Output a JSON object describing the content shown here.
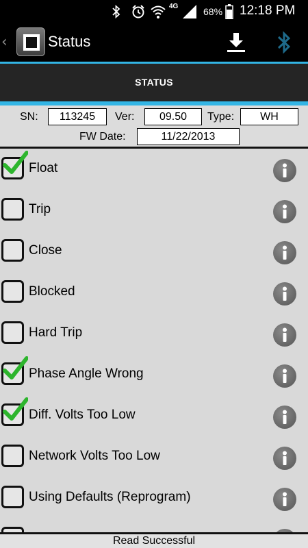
{
  "status_bar": {
    "battery_percent": "68%",
    "network": "4G",
    "time": "12:18 PM",
    "icons": [
      "bluetooth-icon",
      "alarm-icon",
      "wifi-icon",
      "signal-icon",
      "battery-icon"
    ]
  },
  "action_bar": {
    "title": "Status",
    "icons": [
      "back-chevron-icon",
      "app-logo-icon",
      "download-icon",
      "bluetooth-icon"
    ],
    "bluetooth_color": "#1e6a8a"
  },
  "tabs": [
    {
      "label": "STATUS",
      "selected": true
    }
  ],
  "accent_color": "#33b5e5",
  "device_info": {
    "sn_label": "SN:",
    "sn_value": "113245",
    "ver_label": "Ver:",
    "ver_value": "09.50",
    "type_label": "Type:",
    "type_value": "WH",
    "fw_date_label": "FW Date:",
    "fw_date_value": "11/22/2013"
  },
  "status_items": [
    {
      "label": "Float",
      "checked": true
    },
    {
      "label": "Trip",
      "checked": false
    },
    {
      "label": "Close",
      "checked": false
    },
    {
      "label": "Blocked",
      "checked": false
    },
    {
      "label": "Hard Trip",
      "checked": false
    },
    {
      "label": "Phase Angle Wrong",
      "checked": true
    },
    {
      "label": "Diff. Volts Too Low",
      "checked": true
    },
    {
      "label": "Network Volts Too Low",
      "checked": false
    },
    {
      "label": "Using Defaults (Reprogram)",
      "checked": false
    },
    {
      "label": "",
      "checked": false
    }
  ],
  "check_color": "#2db52d",
  "footer": {
    "message": "Read Successful"
  }
}
